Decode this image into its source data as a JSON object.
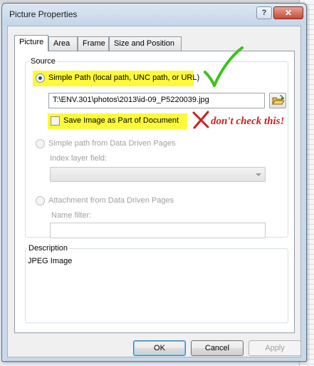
{
  "window": {
    "title": "Picture Properties",
    "help_label": "?",
    "close_label": "✕"
  },
  "tabs": [
    {
      "label": "Picture"
    },
    {
      "label": "Area"
    },
    {
      "label": "Frame"
    },
    {
      "label": "Size and Position"
    }
  ],
  "source": {
    "group_label": "Source",
    "simple_path_label": "Simple Path (local path, UNC path, or URL)",
    "path_value": "T:\\ENV.301\\photos\\2013\\id-09_P5220039.jpg",
    "save_image_label": "Save Image as Part of Document",
    "ddp_path_label": "Simple path from Data Driven Pages",
    "index_layer_label": "Index layer field:",
    "attachment_label": "Attachment from Data Driven Pages",
    "name_filter_label": "Name filter:"
  },
  "annotation": {
    "text": "don't check this!"
  },
  "description": {
    "group_label": "Description",
    "value": "JPEG Image"
  },
  "buttons": {
    "ok": "OK",
    "cancel": "Cancel",
    "apply": "Apply"
  },
  "colors": {
    "highlight": "#fdf93a",
    "checkmark": "#3cc21e",
    "annotation": "#cc1f1f"
  }
}
